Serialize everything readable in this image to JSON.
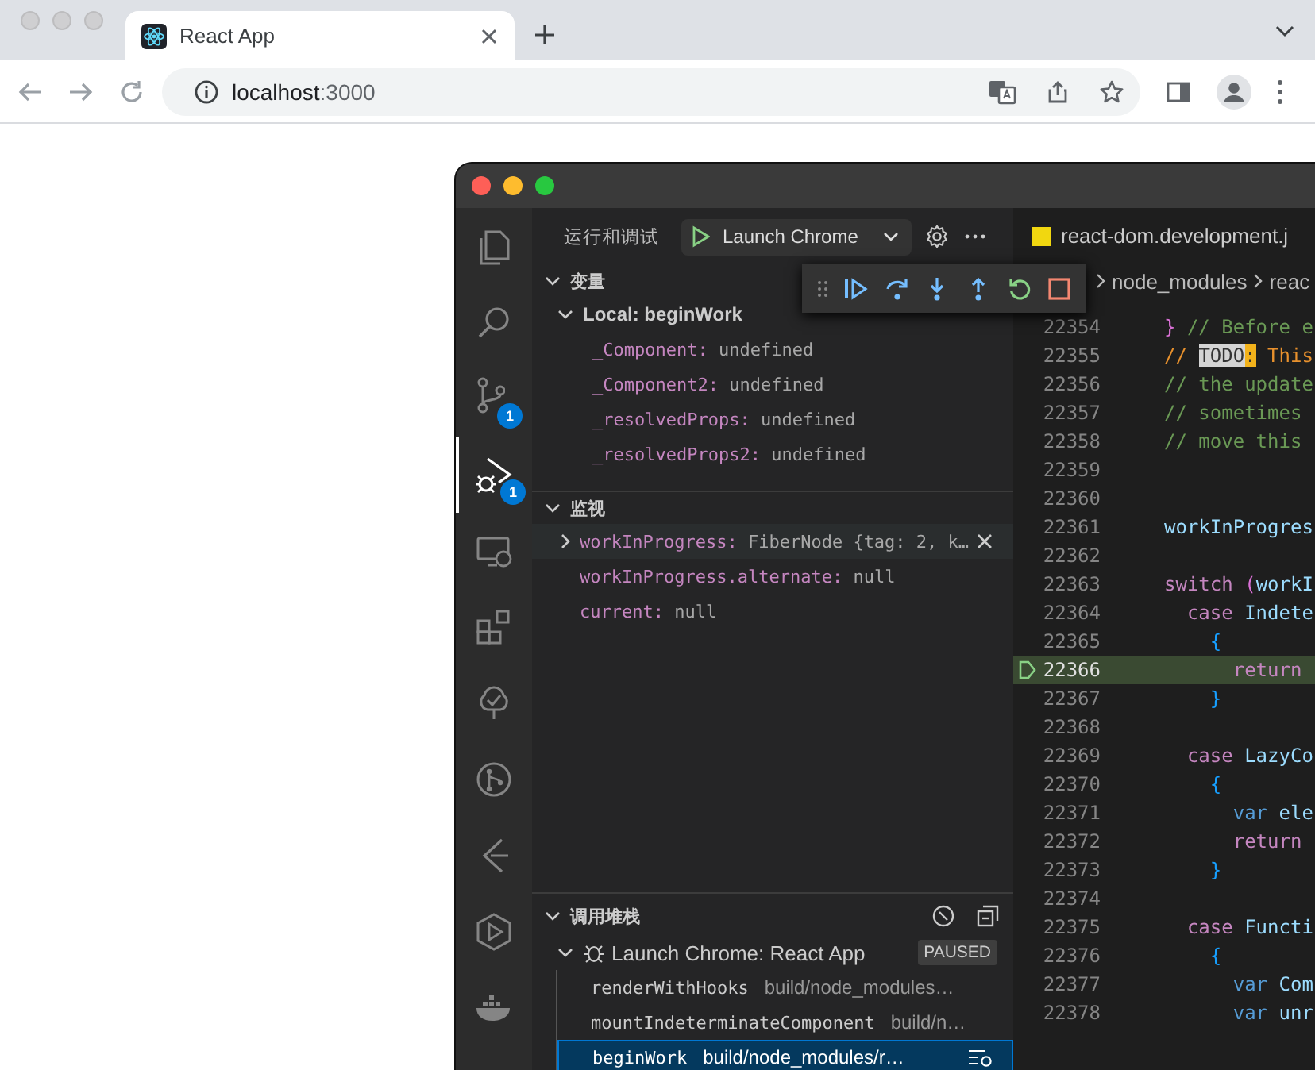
{
  "browser": {
    "tab": {
      "title": "React App",
      "selected": true
    },
    "address": {
      "host": "localhost",
      "port": ":3000"
    }
  },
  "vscode": {
    "activity_bar": [
      {
        "kind": "files",
        "selected": false
      },
      {
        "kind": "search",
        "selected": false
      },
      {
        "kind": "source-control",
        "selected": false,
        "badge": "1"
      },
      {
        "kind": "debug",
        "selected": true,
        "badge": "1"
      },
      {
        "kind": "monitor",
        "selected": false
      },
      {
        "kind": "blocks",
        "selected": false
      },
      {
        "kind": "check-tree",
        "selected": false
      },
      {
        "kind": "git-circle",
        "selected": false
      },
      {
        "kind": "branch-arrow",
        "selected": false
      },
      {
        "kind": "hexagon-play",
        "selected": false
      },
      {
        "kind": "whale",
        "selected": false
      }
    ],
    "sidebar": {
      "title": "运行和调试",
      "launch_config": "Launch Chrome",
      "variables": {
        "title": "变量",
        "expanded": true,
        "scopes": [
          {
            "label": "Local: beginWork",
            "expanded": true,
            "children": [
              {
                "name": "_Component:",
                "value": "undefined"
              },
              {
                "name": "_Component2:",
                "value": "undefined"
              },
              {
                "name": "_resolvedProps:",
                "value": "undefined"
              },
              {
                "name": "_resolvedProps2:",
                "value": "undefined"
              }
            ]
          }
        ]
      },
      "watch": {
        "title": "监视",
        "expanded": true,
        "items": [
          {
            "expression": "workInProgress:",
            "value": "FiberNode {tag: 2, k…",
            "expandable": true,
            "hovered": true
          },
          {
            "expression": "workInProgress.alternate:",
            "value": "null",
            "expandable": false,
            "hovered": false
          },
          {
            "expression": "current:",
            "value": "null",
            "expandable": false,
            "hovered": false
          }
        ]
      },
      "call_stack": {
        "title": "调用堆栈",
        "expanded": true,
        "sessions": [
          {
            "name": "Launch Chrome: React App",
            "state": "PAUSED",
            "expanded": true,
            "frames": [
              {
                "function": "renderWithHooks",
                "file": "build/node_modules…",
                "selected": false
              },
              {
                "function": "mountIndeterminateComponent",
                "file": "build/n…",
                "selected": false
              },
              {
                "function": "beginWork",
                "file": "build/node_modules/r…",
                "selected": true
              }
            ]
          }
        ]
      }
    },
    "editor": {
      "tab": "react-dom.development.j",
      "breadcrumbs": [
        "node_modules",
        "reac"
      ],
      "lines": [
        {
          "number": "22354",
          "current": false,
          "tokens": [
            {
              "text": "}",
              "kind": "bracket2"
            },
            {
              "text": " // Before e",
              "kind": "comment"
            }
          ]
        },
        {
          "number": "22355",
          "current": false,
          "tokens": [
            {
              "text": "// ",
              "kind": "todo-text"
            },
            {
              "text": "TODO",
              "kind": "todo-tag"
            },
            {
              "text": ":",
              "kind": "todo-colon"
            },
            {
              "text": " This",
              "kind": "todo-text"
            }
          ]
        },
        {
          "number": "22356",
          "current": false,
          "tokens": [
            {
              "text": "// the update",
              "kind": "comment"
            }
          ]
        },
        {
          "number": "22357",
          "current": false,
          "tokens": [
            {
              "text": "// sometimes",
              "kind": "comment"
            }
          ]
        },
        {
          "number": "22358",
          "current": false,
          "tokens": [
            {
              "text": "// move this",
              "kind": "comment"
            }
          ]
        },
        {
          "number": "22359",
          "current": false
        },
        {
          "number": "22360",
          "current": false
        },
        {
          "number": "22361",
          "current": false,
          "tokens": [
            {
              "text": "workInProgres",
              "kind": "variable"
            }
          ]
        },
        {
          "number": "22362",
          "current": false
        },
        {
          "number": "22363",
          "current": false,
          "tokens": [
            {
              "text": "switch",
              "kind": "keyword"
            },
            {
              "text": " (",
              "kind": "bracket2"
            },
            {
              "text": "workI",
              "kind": "variable"
            }
          ]
        },
        {
          "number": "22364",
          "current": false,
          "tokens": [
            {
              "text": "  case",
              "kind": "keyword"
            },
            {
              "text": " Indete",
              "kind": "variable"
            }
          ]
        },
        {
          "number": "22365",
          "current": false,
          "tokens": [
            {
              "text": "    {",
              "kind": "bracket3"
            }
          ]
        },
        {
          "number": "22366",
          "current": true,
          "tokens": [
            {
              "text": "      return",
              "kind": "keyword"
            }
          ]
        },
        {
          "number": "22367",
          "current": false,
          "tokens": [
            {
              "text": "    }",
              "kind": "bracket3"
            }
          ]
        },
        {
          "number": "22368",
          "current": false
        },
        {
          "number": "22369",
          "current": false,
          "tokens": [
            {
              "text": "  case",
              "kind": "keyword"
            },
            {
              "text": " LazyCo",
              "kind": "variable"
            }
          ]
        },
        {
          "number": "22370",
          "current": false,
          "tokens": [
            {
              "text": "    {",
              "kind": "bracket3"
            }
          ]
        },
        {
          "number": "22371",
          "current": false,
          "tokens": [
            {
              "text": "      var",
              "kind": "storage"
            },
            {
              "text": " ele",
              "kind": "variable"
            }
          ]
        },
        {
          "number": "22372",
          "current": false,
          "tokens": [
            {
              "text": "      return",
              "kind": "keyword"
            }
          ]
        },
        {
          "number": "22373",
          "current": false,
          "tokens": [
            {
              "text": "    }",
              "kind": "bracket3"
            }
          ]
        },
        {
          "number": "22374",
          "current": false
        },
        {
          "number": "22375",
          "current": false,
          "tokens": [
            {
              "text": "  case",
              "kind": "keyword"
            },
            {
              "text": " Functi",
              "kind": "variable"
            }
          ]
        },
        {
          "number": "22376",
          "current": false,
          "tokens": [
            {
              "text": "    {",
              "kind": "bracket3"
            }
          ]
        },
        {
          "number": "22377",
          "current": false,
          "tokens": [
            {
              "text": "      var",
              "kind": "storage"
            },
            {
              "text": " Com",
              "kind": "variable"
            }
          ]
        },
        {
          "number": "22378",
          "current": false,
          "tokens": [
            {
              "text": "      var",
              "kind": "storage"
            },
            {
              "text": " unr",
              "kind": "variable"
            }
          ]
        }
      ]
    }
  }
}
